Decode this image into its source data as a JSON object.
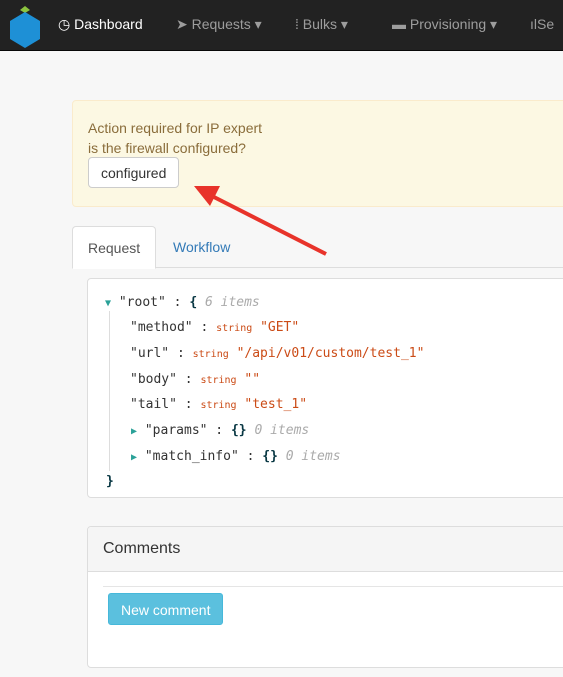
{
  "nav": {
    "items": [
      {
        "label": "Dashboard",
        "icon": "dashboard-icon"
      },
      {
        "label": "Requests",
        "icon": "paper-plane-icon"
      },
      {
        "label": "Bulks",
        "icon": "bulk-icon"
      },
      {
        "label": "Provisioning",
        "icon": "hdd-icon"
      },
      {
        "label": "Se",
        "icon": "signal-icon"
      }
    ]
  },
  "alert": {
    "line1": "Action required for IP expert",
    "line2": "is the firewall configured?",
    "button": "configured"
  },
  "tabs": [
    {
      "label": "Request"
    },
    {
      "label": "Workflow"
    }
  ],
  "json": {
    "root_key": "\"root\"",
    "root_count": "6 items",
    "fields": [
      {
        "key": "\"method\"",
        "type": "string",
        "value": "\"GET\""
      },
      {
        "key": "\"url\"",
        "type": "string",
        "value": "\"/api/v01/custom/test_1\""
      },
      {
        "key": "\"body\"",
        "type": "string",
        "value": "\"\""
      },
      {
        "key": "\"tail\"",
        "type": "string",
        "value": "\"test_1\""
      }
    ],
    "objects": [
      {
        "key": "\"params\"",
        "count": "0 items"
      },
      {
        "key": "\"match_info\"",
        "count": "0 items"
      }
    ]
  },
  "comments": {
    "title": "Comments",
    "new_button": "New comment"
  },
  "colors": {
    "navbar": "#222222",
    "alert_bg": "#fcf8e3",
    "accent": "#5bc0de",
    "arrow": "#e8332a"
  }
}
